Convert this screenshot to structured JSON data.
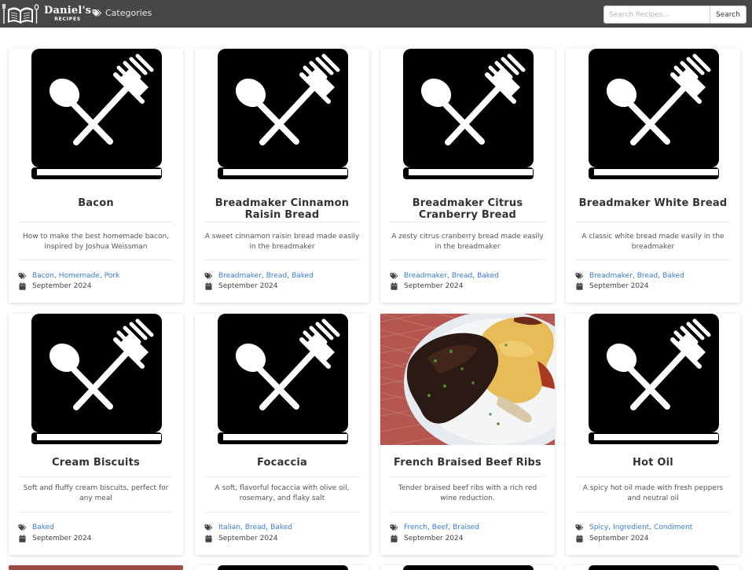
{
  "brand": {
    "name": "Daniel's",
    "sub": "RECIPES"
  },
  "nav": {
    "categories_label": "Categories"
  },
  "search": {
    "placeholder": "Search Recipes...",
    "button_label": "Search"
  },
  "recipes": [
    {
      "title": "Bacon",
      "description": "How to make the best homemade bacon, inspired by Joshua Weissman",
      "tags": [
        "Bacon",
        "Homemade",
        "Pork"
      ],
      "date": "September 2024",
      "image": "placeholder-book-icon"
    },
    {
      "title": "Breadmaker Cinnamon Raisin Bread",
      "description": "A sweet cinnamon raisin bread made easily in the breadmaker",
      "tags": [
        "Breadmaker",
        "Bread",
        "Baked"
      ],
      "date": "September 2024",
      "image": "placeholder-book-icon"
    },
    {
      "title": "Breadmaker Citrus Cranberry Bread",
      "description": "A zesty citrus cranberry bread made easily in the breadmaker",
      "tags": [
        "Breadmaker",
        "Bread",
        "Baked"
      ],
      "date": "September 2024",
      "image": "placeholder-book-icon"
    },
    {
      "title": "Breadmaker White Bread",
      "description": "A classic white bread made easily in the breadmaker",
      "tags": [
        "Breadmaker",
        "Bread",
        "Baked"
      ],
      "date": "September 2024",
      "image": "placeholder-book-icon"
    },
    {
      "title": "Cream Biscuits",
      "description": "Soft and fluffy cream biscuits, perfect for any meal",
      "tags": [
        "Baked"
      ],
      "date": "September 2024",
      "image": "placeholder-book-icon"
    },
    {
      "title": "Focaccia",
      "description": "A soft, flavorful focaccia with olive oil, rosemary, and flaky salt",
      "tags": [
        "Italian",
        "Bread",
        "Baked"
      ],
      "date": "September 2024",
      "image": "placeholder-book-icon"
    },
    {
      "title": "French Braised Beef Ribs",
      "description": "Tender braised beef ribs with a rich red wine reduction.",
      "tags": [
        "French",
        "Beef",
        "Braised"
      ],
      "date": "September 2024",
      "image": "photo-braised-beef-ribs"
    },
    {
      "title": "Hot Oil",
      "description": "A spicy hot oil made with fresh peppers and neutral oil",
      "tags": [
        "Spicy",
        "Ingredient",
        "Condiment"
      ],
      "date": "September 2024",
      "image": "placeholder-book-icon"
    }
  ],
  "colors": {
    "navbar": "#474747",
    "link": "#3a7bd5",
    "card_bg": "#ffffff"
  },
  "icons": {
    "categories": "tags-icon",
    "tags": "tags-icon",
    "date": "calendar-icon"
  }
}
